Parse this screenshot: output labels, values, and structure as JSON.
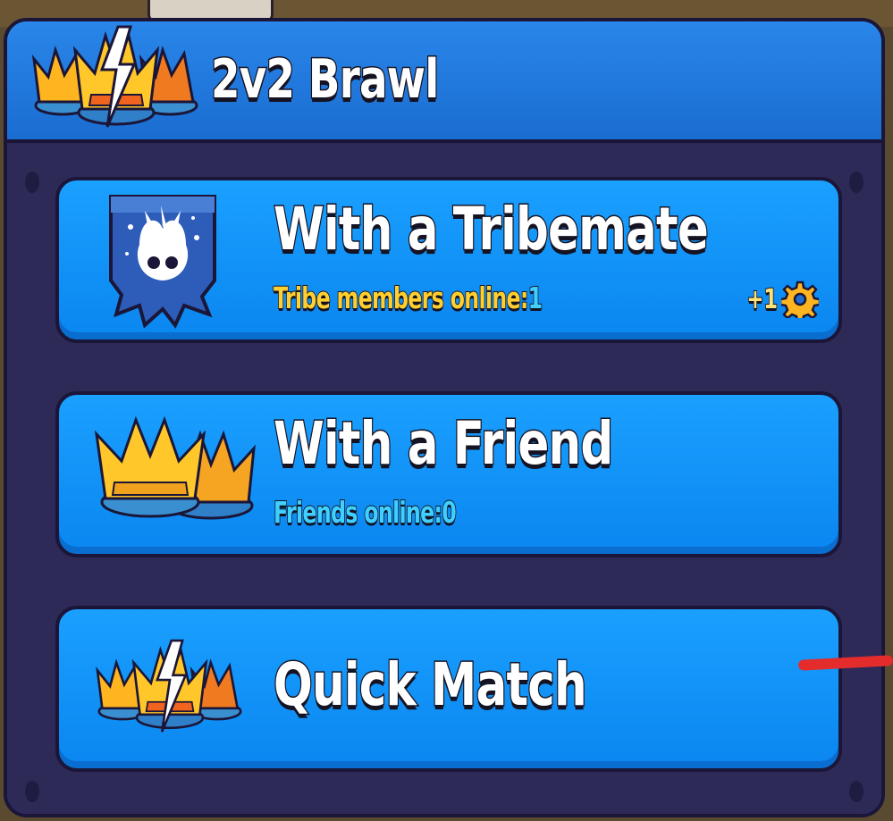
{
  "header": {
    "title": "2v2 Brawl"
  },
  "options": [
    {
      "title": "With a Tribemate",
      "subtitle_label": "Tribe members online:",
      "subtitle_value": "1",
      "reward": "+1"
    },
    {
      "title": "With a Friend",
      "subtitle_label": "Friends online:",
      "subtitle_value": "0"
    },
    {
      "title": "Quick Match"
    }
  ],
  "colors": {
    "panel_blue": "#1e6fd0",
    "card_blue": "#0a86f0",
    "inner_navy": "#2d2a58",
    "outline": "#1b1638",
    "label_yellow": "#ffcf2e",
    "label_cyan": "#3fd0ff",
    "annotation_red": "#e52c2c"
  },
  "icons": {
    "header": "crowns-lightning-icon",
    "tribemate": "tribe-banner-icon",
    "friend": "double-crown-icon",
    "quick_match": "crowns-lightning-icon",
    "reward": "gear-icon"
  }
}
